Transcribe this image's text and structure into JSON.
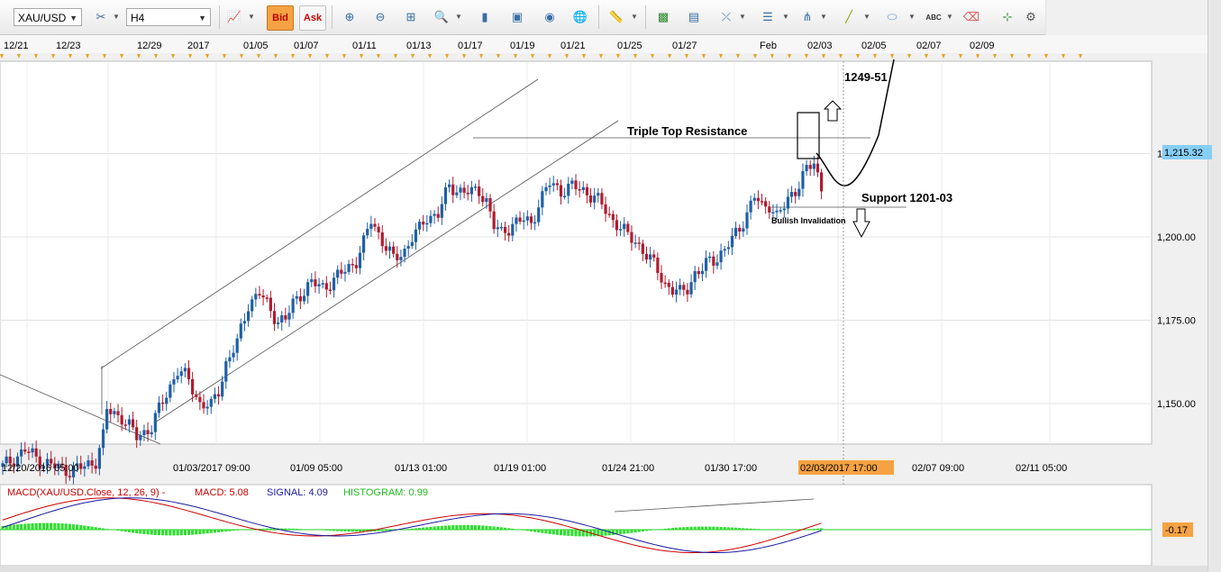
{
  "toolbar": {
    "symbol": "XAU/USD",
    "timeframe": "H4",
    "bid_label": "Bid",
    "ask_label": "Ask",
    "text_tool_label": "ABC",
    "icons": [
      "indicator-icon",
      "chart-type-icon",
      "bid-icon",
      "ask-icon",
      "crosshair-icon",
      "zoom-icon",
      "measure-icon",
      "magnifier-icon",
      "candle-icon",
      "picture-icon",
      "eye-icon",
      "globe-icon",
      "ruler-icon",
      "image-icon",
      "template-icon",
      "fibonacci-icon",
      "lines-icon",
      "pitchfork-icon",
      "trendline-icon",
      "ellipse-icon",
      "text-icon",
      "eraser-icon",
      "objects-icon"
    ]
  },
  "top_dates": [
    "12/21",
    "12/23",
    "12/29",
    "2017",
    "01/05",
    "01/07",
    "01/11",
    "01/13",
    "01/17",
    "01/19",
    "01/21",
    "01/25",
    "01/27",
    "Feb",
    "02/03",
    "02/05",
    "02/07",
    "02/09"
  ],
  "bottom_times": [
    "12/20/2016 05:00",
    "01/03/2017 09:00",
    "01/09 05:00",
    "01/13 01:00",
    "01/19 01:00",
    "01/24 21:00",
    "01/30 17:00",
    "02/07 09:00",
    "02/11 05:00"
  ],
  "crosshair_time": "02/03/2017 17:00",
  "price_axis": [
    "1,225.00",
    "1,200.00",
    "1,175.00",
    "1,150.00"
  ],
  "current_price": "1,215.32",
  "annotations": {
    "target": "1249-51",
    "resistance": "Triple Top Resistance",
    "support": "Support 1201-03",
    "invalidation": "Bullish Invalidation"
  },
  "macd": {
    "title": "MACD(XAU/USD.Close, 12, 26, 9) -",
    "macd_label": "MACD: 5.08",
    "signal_label": "SIGNAL: 4.09",
    "histogram_label": "HISTOGRAM: 0.99",
    "axis_value": "-0.17",
    "colors": {
      "macd": "#cc0000",
      "signal": "#1a1aa0",
      "histogram": "#33dd33"
    }
  },
  "colors": {
    "bull": "#1f5fa8",
    "bear": "#b01c2e",
    "price_tag": "#87cef5",
    "time_tag": "#f5a243"
  },
  "chart_data": {
    "type": "candlestick",
    "symbol": "XAU/USD",
    "timeframe": "H4",
    "ylim": [
      1127,
      1252
    ],
    "grid": true,
    "close_path": [
      [
        0,
        1131
      ],
      [
        6,
        1136
      ],
      [
        10,
        1133
      ],
      [
        14,
        1131
      ],
      [
        18,
        1130
      ],
      [
        22,
        1131
      ],
      [
        25,
        1133
      ],
      [
        27,
        1140
      ],
      [
        28,
        1148
      ],
      [
        32,
        1146
      ],
      [
        36,
        1140
      ],
      [
        40,
        1143
      ],
      [
        44,
        1153
      ],
      [
        47,
        1160
      ],
      [
        50,
        1157
      ],
      [
        53,
        1150
      ],
      [
        56,
        1149
      ],
      [
        58,
        1154
      ],
      [
        60,
        1162
      ],
      [
        63,
        1168
      ],
      [
        66,
        1180
      ],
      [
        69,
        1183
      ],
      [
        72,
        1178
      ],
      [
        74,
        1175
      ],
      [
        76,
        1175
      ],
      [
        78,
        1180
      ],
      [
        80,
        1183
      ],
      [
        83,
        1186
      ],
      [
        86,
        1185
      ],
      [
        89,
        1187
      ],
      [
        92,
        1190
      ],
      [
        95,
        1193
      ],
      [
        97,
        1198
      ],
      [
        99,
        1205
      ],
      [
        102,
        1199
      ],
      [
        105,
        1193
      ],
      [
        108,
        1196
      ],
      [
        110,
        1200
      ],
      [
        112,
        1202
      ],
      [
        114,
        1206
      ],
      [
        117,
        1207
      ],
      [
        120,
        1215
      ],
      [
        123,
        1214
      ],
      [
        126,
        1213
      ],
      [
        128,
        1214
      ],
      [
        130,
        1211
      ],
      [
        132,
        1203
      ],
      [
        134,
        1201
      ],
      [
        137,
        1204
      ],
      [
        140,
        1205
      ],
      [
        142,
        1204
      ],
      [
        144,
        1210
      ],
      [
        147,
        1216
      ],
      [
        150,
        1214
      ],
      [
        153,
        1215
      ],
      [
        156,
        1214
      ],
      [
        159,
        1212
      ],
      [
        162,
        1208
      ],
      [
        164,
        1205
      ],
      [
        166,
        1203
      ],
      [
        168,
        1200
      ],
      [
        170,
        1199
      ],
      [
        172,
        1196
      ],
      [
        174,
        1193
      ],
      [
        176,
        1190
      ],
      [
        178,
        1186
      ],
      [
        180,
        1184
      ],
      [
        182,
        1183
      ],
      [
        184,
        1185
      ],
      [
        186,
        1189
      ],
      [
        188,
        1190
      ],
      [
        190,
        1193
      ],
      [
        192,
        1194
      ],
      [
        194,
        1196
      ],
      [
        196,
        1199
      ],
      [
        198,
        1203
      ],
      [
        200,
        1207
      ],
      [
        202,
        1212
      ],
      [
        204,
        1209
      ],
      [
        206,
        1210
      ],
      [
        208,
        1206
      ],
      [
        210,
        1209
      ],
      [
        212,
        1213
      ],
      [
        214,
        1216
      ],
      [
        216,
        1220
      ],
      [
        218,
        1222
      ],
      [
        220,
        1215
      ]
    ]
  }
}
